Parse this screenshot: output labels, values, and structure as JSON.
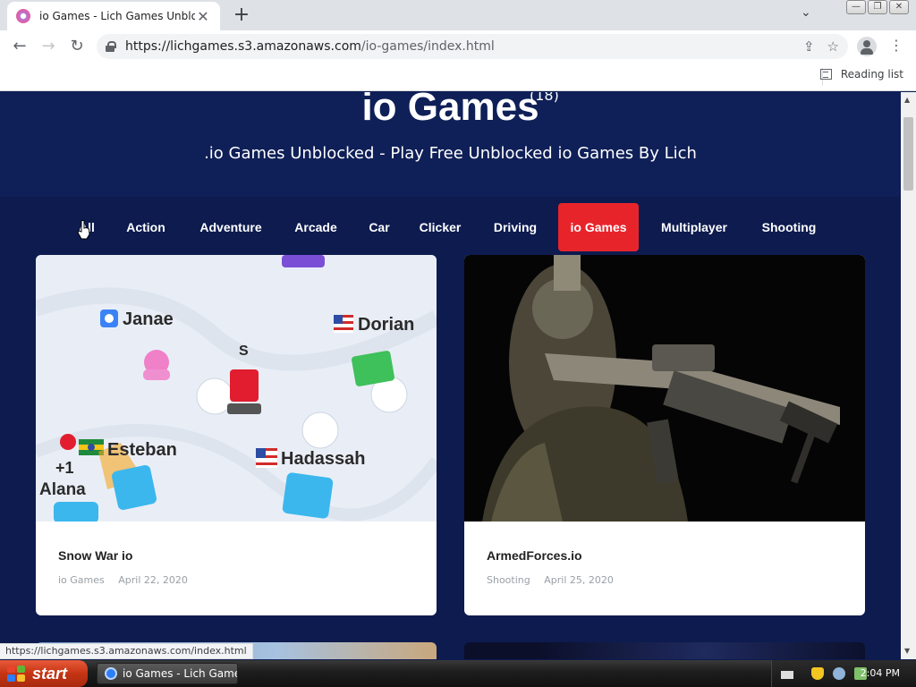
{
  "browser": {
    "tab_title": "io Games - Lich Games Unblocked",
    "tab_close": "✕",
    "new_tab": "+",
    "tab_dropdown": "⌄",
    "url_host": "https://lichgames.s3.amazonaws.com",
    "url_path": "/io-games/index.html",
    "reading_list": "Reading list",
    "status_url": "https://lichgames.s3.amazonaws.com/index.html",
    "win_minimize": "—",
    "win_restore": "❐",
    "win_close": "✕"
  },
  "hero": {
    "title": "io Games",
    "count": "(18)",
    "subtitle": ".io Games Unblocked - Play Free Unblocked io Games By Lich"
  },
  "categories": [
    "All",
    "Action",
    "Adventure",
    "Arcade",
    "Car",
    "Clicker",
    "Driving",
    "io Games",
    "Multiplayer",
    "Shooting"
  ],
  "active_category": "io Games",
  "games": [
    {
      "title": "Snow War io",
      "category": "io Games",
      "date": "April 22, 2020",
      "thumb_labels": {
        "janae": "Janae",
        "dorian": "Dorian",
        "esteban": "Esteban",
        "hadassah": "Hadassah",
        "alana": "Alana",
        "s": "S",
        "plus_one": "+1"
      }
    },
    {
      "title": "ArmedForces.io",
      "category": "Shooting",
      "date": "April 25, 2020"
    }
  ],
  "taskbar": {
    "start": "start",
    "task_label": "io Games - Lich Game...",
    "clock": "2:04 PM"
  },
  "colors": {
    "page_bg": "#0d1b4f",
    "active_category": "#e8242b",
    "start_button": "#c53413"
  }
}
